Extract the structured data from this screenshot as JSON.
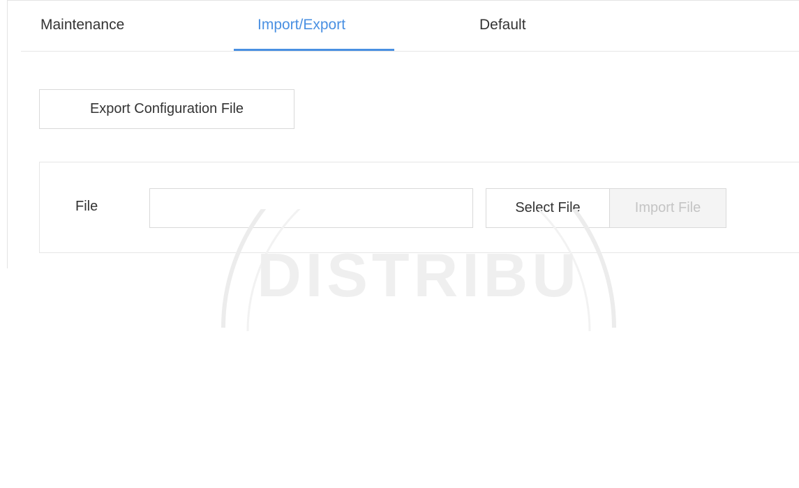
{
  "tabs": [
    {
      "label": "Maintenance",
      "active": false
    },
    {
      "label": "Import/Export",
      "active": true
    },
    {
      "label": "Default",
      "active": false
    }
  ],
  "export_button": {
    "label": "Export Configuration File"
  },
  "import_section": {
    "file_label": "File",
    "file_value": "",
    "select_button": "Select File",
    "import_button": "Import File",
    "import_disabled": true
  },
  "watermark": "DISTRIBU",
  "colors": {
    "accent": "#4a90e2",
    "border": "#d9d9d9",
    "disabled_text": "#c4c4c4"
  }
}
